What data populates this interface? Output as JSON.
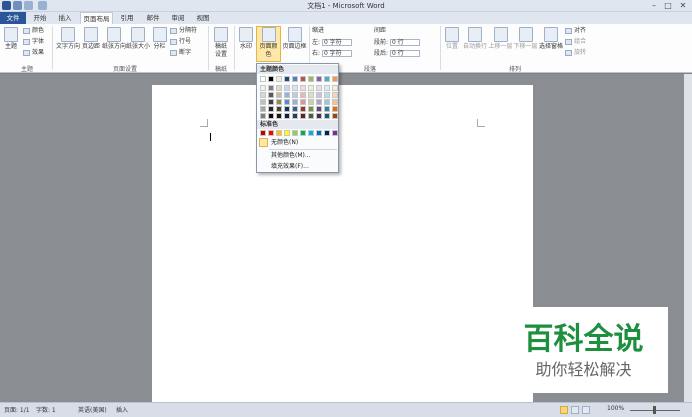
{
  "window": {
    "title": "文档1 - Microsoft Word"
  },
  "tabs": [
    {
      "label": "文件"
    },
    {
      "label": "开始"
    },
    {
      "label": "插入"
    },
    {
      "label": "页面布局"
    },
    {
      "label": "引用"
    },
    {
      "label": "邮件"
    },
    {
      "label": "审阅"
    },
    {
      "label": "视图"
    }
  ],
  "ribbon": {
    "theme_group": {
      "themes": "主题",
      "colors": "颜色",
      "fonts": "字体",
      "effects": "效果",
      "label": "主题"
    },
    "page_setup": {
      "text_dir": "文字方向",
      "margins": "页边距",
      "orientation": "纸张方向",
      "size": "纸张大小",
      "columns": "分栏",
      "breaks": "分隔符",
      "line_numbers": "行号",
      "hyphenation": "断字",
      "label": "页面设置"
    },
    "draft_group": {
      "draft": "稿纸",
      "draft2": "设置",
      "label": "稿纸"
    },
    "background": {
      "watermark": "水印",
      "page_color": "页面颜色",
      "page_border": "页面边框"
    },
    "paragraph": {
      "indent": "缩进",
      "spacing": "间距",
      "left": "左:",
      "right": "右:",
      "before": "段前:",
      "after": "段后:",
      "indent_left_val": "0 字符",
      "indent_right_val": "0 字符",
      "before_val": "0 行",
      "after_val": "0 行",
      "label": "段落"
    },
    "arrange": {
      "position": "位置",
      "wrap": "自动换行",
      "forward": "上移一层",
      "backward": "下移一层",
      "selection": "选择窗格",
      "align": "对齐",
      "group": "组合",
      "rotate": "旋转",
      "label": "排列"
    }
  },
  "dropdown": {
    "theme_colors": "主题颜色",
    "standard_colors": "标准色",
    "no_color": "无颜色(N)",
    "more_colors": "其他颜色(M)...",
    "fill_effects": "填充效果(F)...",
    "theme_top": [
      "#ffffff",
      "#000000",
      "#eeece1",
      "#1f497d",
      "#4f81bd",
      "#c0504d",
      "#9bbb59",
      "#8064a2",
      "#4bacc6",
      "#f79646"
    ],
    "theme_shades": [
      [
        "#f2f2f2",
        "#7f7f7f",
        "#ddd9c3",
        "#c6d9f0",
        "#dbe5f1",
        "#f2dcdb",
        "#ebf1dd",
        "#e5e0ec",
        "#dbeef3",
        "#fdeada"
      ],
      [
        "#d8d8d8",
        "#595959",
        "#c4bd97",
        "#8db3e2",
        "#b8cce4",
        "#e5b9b7",
        "#d7e3bc",
        "#ccc1d9",
        "#b7dde8",
        "#fbd5b5"
      ],
      [
        "#bfbfbf",
        "#3f3f3f",
        "#938953",
        "#548dd4",
        "#95b3d7",
        "#d99694",
        "#c3d69b",
        "#b2a2c7",
        "#92cddc",
        "#fac08f"
      ],
      [
        "#a5a5a5",
        "#262626",
        "#494429",
        "#17365d",
        "#366092",
        "#953734",
        "#76923c",
        "#5f497a",
        "#31859b",
        "#e36c09"
      ],
      [
        "#7f7f7f",
        "#0c0c0c",
        "#1d1b10",
        "#0f243e",
        "#244061",
        "#632423",
        "#4f6128",
        "#3f3151",
        "#205867",
        "#974806"
      ]
    ],
    "standard": [
      "#c00000",
      "#ff0000",
      "#ffc000",
      "#ffff00",
      "#92d050",
      "#00b050",
      "#00b0f0",
      "#0070c0",
      "#002060",
      "#7030a0"
    ]
  },
  "status": {
    "page": "页面: 1/1",
    "words": "字数: 1",
    "lang": "英语(美国)",
    "mode": "插入",
    "zoom": "100%"
  },
  "watermark": {
    "title": "百科全说",
    "subtitle": "助你轻松解决"
  }
}
